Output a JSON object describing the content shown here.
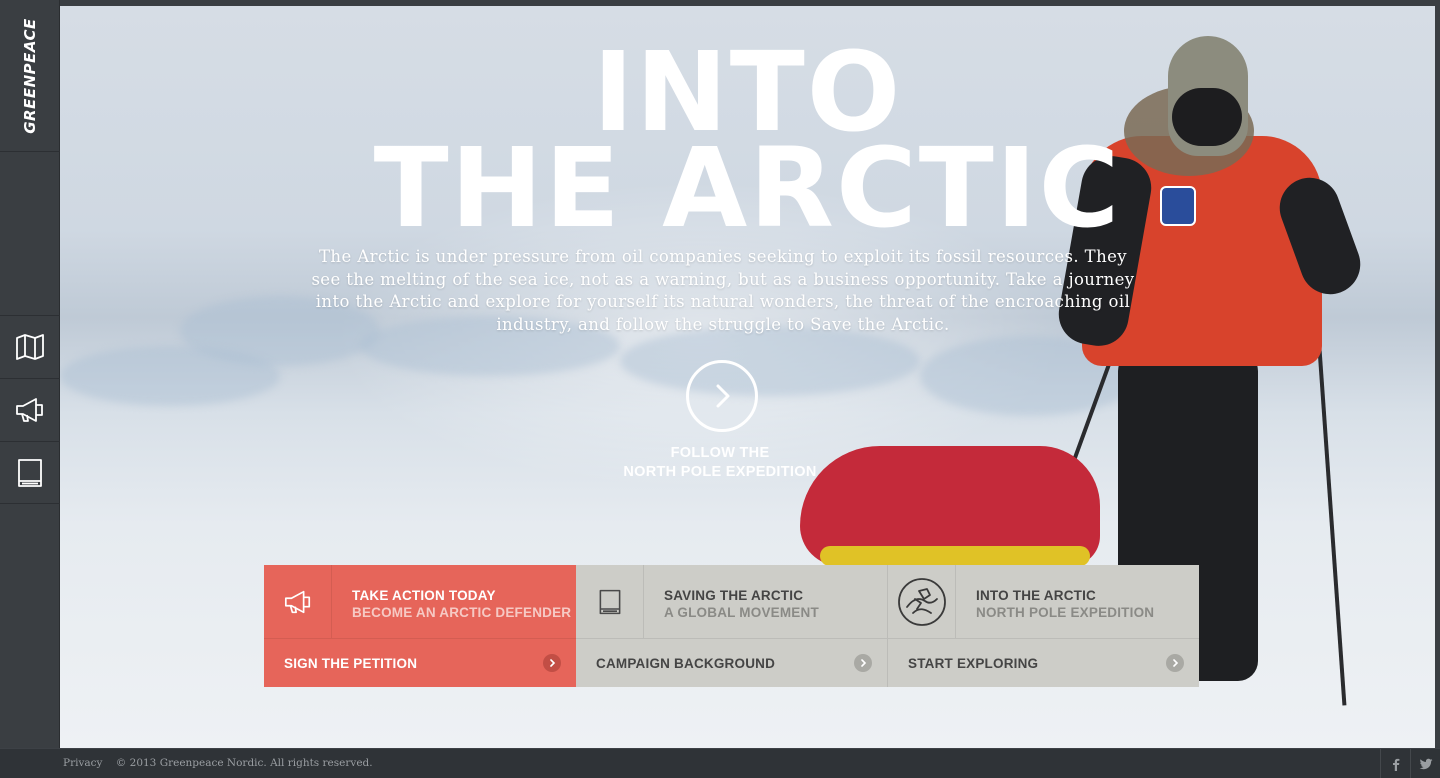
{
  "sidebar": {
    "logo": "GREENPEACE",
    "nav": [
      {
        "icon": "map-icon"
      },
      {
        "icon": "megaphone-icon"
      },
      {
        "icon": "book-icon"
      }
    ]
  },
  "hero": {
    "title_line1": "INTO",
    "title_line2": "THE ARCTIC",
    "lead": "The Arctic is under pressure from oil companies seeking to exploit its fossil resources. They see the melting of the sea ice, not as a warning, but as a business opportunity. Take a journey into the Arctic and explore for yourself its natural wonders, the threat of the encroaching oil industry, and follow the struggle to Save the Arctic.",
    "follow_icon": "chevron-right-icon",
    "follow_line1": "FOLLOW THE",
    "follow_line2": "NORTH POLE EXPEDITION"
  },
  "cards": [
    {
      "icon": "megaphone-icon",
      "title": "TAKE ACTION TODAY",
      "subtitle": "BECOME AN ARCTIC DEFENDER",
      "action": "SIGN THE PETITION",
      "accent": "#e6655a"
    },
    {
      "icon": "book-icon",
      "title": "SAVING THE ARCTIC",
      "subtitle": "A GLOBAL MOVEMENT",
      "action": "CAMPAIGN BACKGROUND",
      "accent": "#cdcdc8"
    },
    {
      "icon": "expedition-emblem-icon",
      "title": "INTO THE ARCTIC",
      "subtitle": "NORTH POLE EXPEDITION",
      "action": "START EXPLORING",
      "accent": "#cdcdc8"
    }
  ],
  "footer": {
    "privacy": "Privacy",
    "copyright": "© 2013 Greenpeace Nordic. All rights reserved.",
    "social": [
      "facebook-icon",
      "twitter-icon"
    ]
  }
}
